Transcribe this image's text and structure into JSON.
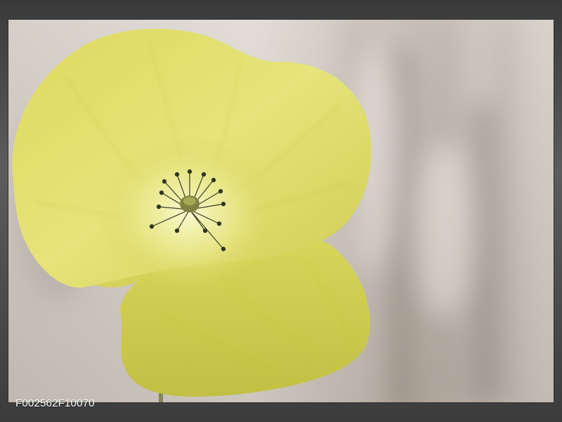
{
  "artwork": {
    "product_code": "F002562F10070"
  },
  "colors": {
    "background_light": "#d8d2ca",
    "background_dark": "#8e857d",
    "petal_base": "#d6d45a",
    "petal_light": "#f0ef9e",
    "petal_shadow": "#a8a636",
    "stamen": "#2e3320",
    "frame": "#3a3a3a"
  },
  "icons": [
    "poppy-flower"
  ]
}
